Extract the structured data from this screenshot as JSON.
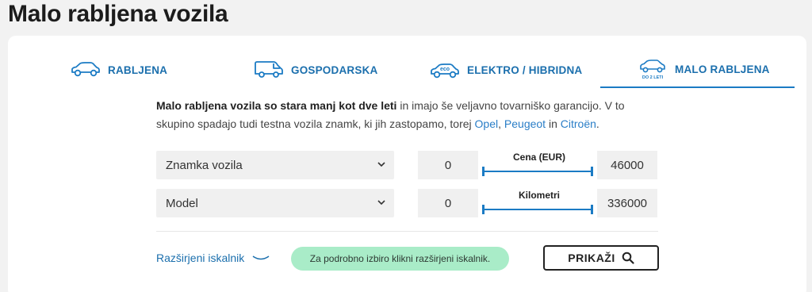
{
  "page": {
    "title": "Malo rabljena vozila"
  },
  "tabs": [
    {
      "label": "RABLJENA",
      "icon": "car-icon"
    },
    {
      "label": "GOSPODARSKA",
      "icon": "van-icon"
    },
    {
      "label": "ELEKTRO / HIBRIDNA",
      "icon": "eco-car-icon",
      "badge": "eco"
    },
    {
      "label": "MALO RABLJENA",
      "icon": "nearly-new-car-icon",
      "badge": "DO 2 LETI",
      "active": true
    }
  ],
  "description": {
    "bold": "Malo rabljena vozila so stara manj kot dve leti",
    "text1": " in imajo še veljavno tovarniško garancijo. V to skupino spadajo tudi testna vozila znamk, ki jih zastopamo, torej ",
    "brand1": "Opel",
    "sep1": ", ",
    "brand2": "Peugeot",
    "sep2": " in ",
    "brand3": "Citroën",
    "end": "."
  },
  "filters": {
    "brand_select": "Znamka vozila",
    "model_select": "Model",
    "price": {
      "label": "Cena (EUR)",
      "min": "0",
      "max": "46000"
    },
    "km": {
      "label": "Kilometri",
      "min": "0",
      "max": "336000"
    }
  },
  "footer": {
    "advanced_link": "Razširjeni iskalnik",
    "hint": "Za podrobno izbiro klikni razširjeni iskalnik.",
    "show_button": "PRIKAŽI"
  },
  "colors": {
    "accent": "#1b7bc4",
    "hint_bg": "#a9ecc8"
  }
}
